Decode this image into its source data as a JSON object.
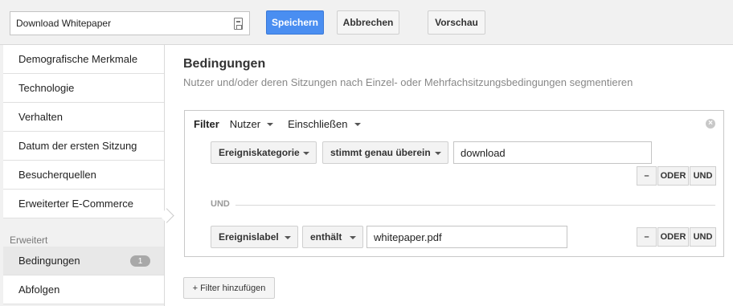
{
  "topbar": {
    "segment_name": "Download Whitepaper",
    "save_label": "Speichern",
    "cancel_label": "Abbrechen",
    "preview_label": "Vorschau"
  },
  "sidebar": {
    "items": [
      {
        "label": "Demografische Merkmale"
      },
      {
        "label": "Technologie"
      },
      {
        "label": "Verhalten"
      },
      {
        "label": "Datum der ersten Sitzung"
      },
      {
        "label": "Besucherquellen"
      },
      {
        "label": "Erweiterter E-Commerce"
      }
    ],
    "section_label": "Erweitert",
    "advanced_items": [
      {
        "label": "Bedingungen",
        "badge": "1",
        "active": true
      },
      {
        "label": "Abfolgen"
      }
    ]
  },
  "main": {
    "title": "Bedingungen",
    "subtitle": "Nutzer und/oder deren Sitzungen nach Einzel- oder Mehrfachsitzungsbedingungen segmentieren",
    "filter": {
      "label": "Filter",
      "scope": "Nutzer",
      "mode": "Einschließen",
      "close_symbol": "×",
      "conditions": [
        {
          "dimension": "Ereigniskategorie",
          "operator": "stimmt genau überein",
          "value": "download"
        },
        {
          "dimension": "Ereignislabel",
          "operator": "enthält",
          "value": "whitepaper.pdf"
        }
      ],
      "and_separator": "UND",
      "minus_label": "–",
      "or_label": "ODER",
      "and_label": "UND"
    },
    "add_filter_label": "+ Filter hinzufügen"
  },
  "colors": {
    "primary_button": "#4a8ef1",
    "sidebar_bg": "#f1f1f1",
    "badge_bg": "#a8a8a8"
  }
}
